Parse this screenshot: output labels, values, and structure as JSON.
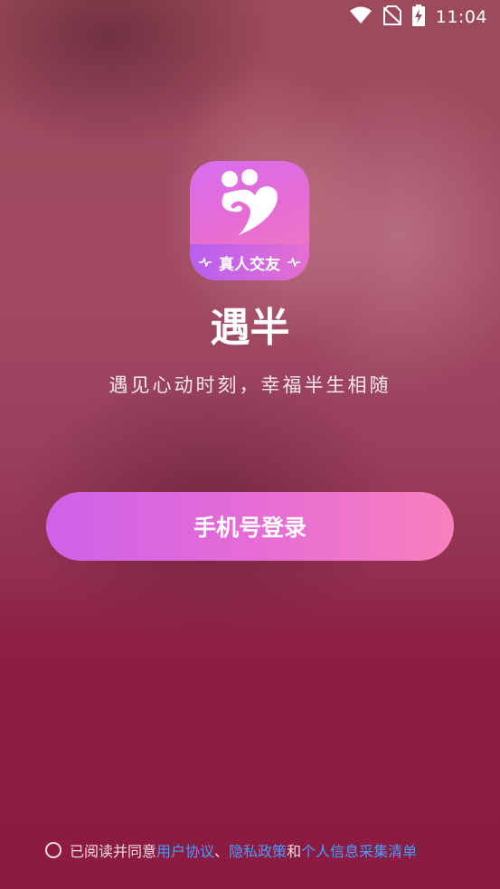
{
  "status_bar": {
    "time": "11:04",
    "icons": [
      "wifi-icon",
      "no-sim-icon",
      "battery-charging-icon"
    ]
  },
  "logo": {
    "band_text": "真人交友",
    "icon": "heart-icon"
  },
  "app_name": "遇半",
  "slogan": "遇见心动时刻，幸福半生相随",
  "login_button": "手机号登录",
  "agreement": {
    "prefix": "已阅读并同意",
    "user_agreement": "用户协议",
    "separator": "、",
    "privacy_policy": "隐私政策",
    "conjunction": "和",
    "info_list": "个人信息采集清单",
    "checked": false
  },
  "colors": {
    "button_gradient_start": "#cf62e8",
    "button_gradient_end": "#f880bd",
    "link": "#4a9dff",
    "background": "#8c1d3f"
  }
}
